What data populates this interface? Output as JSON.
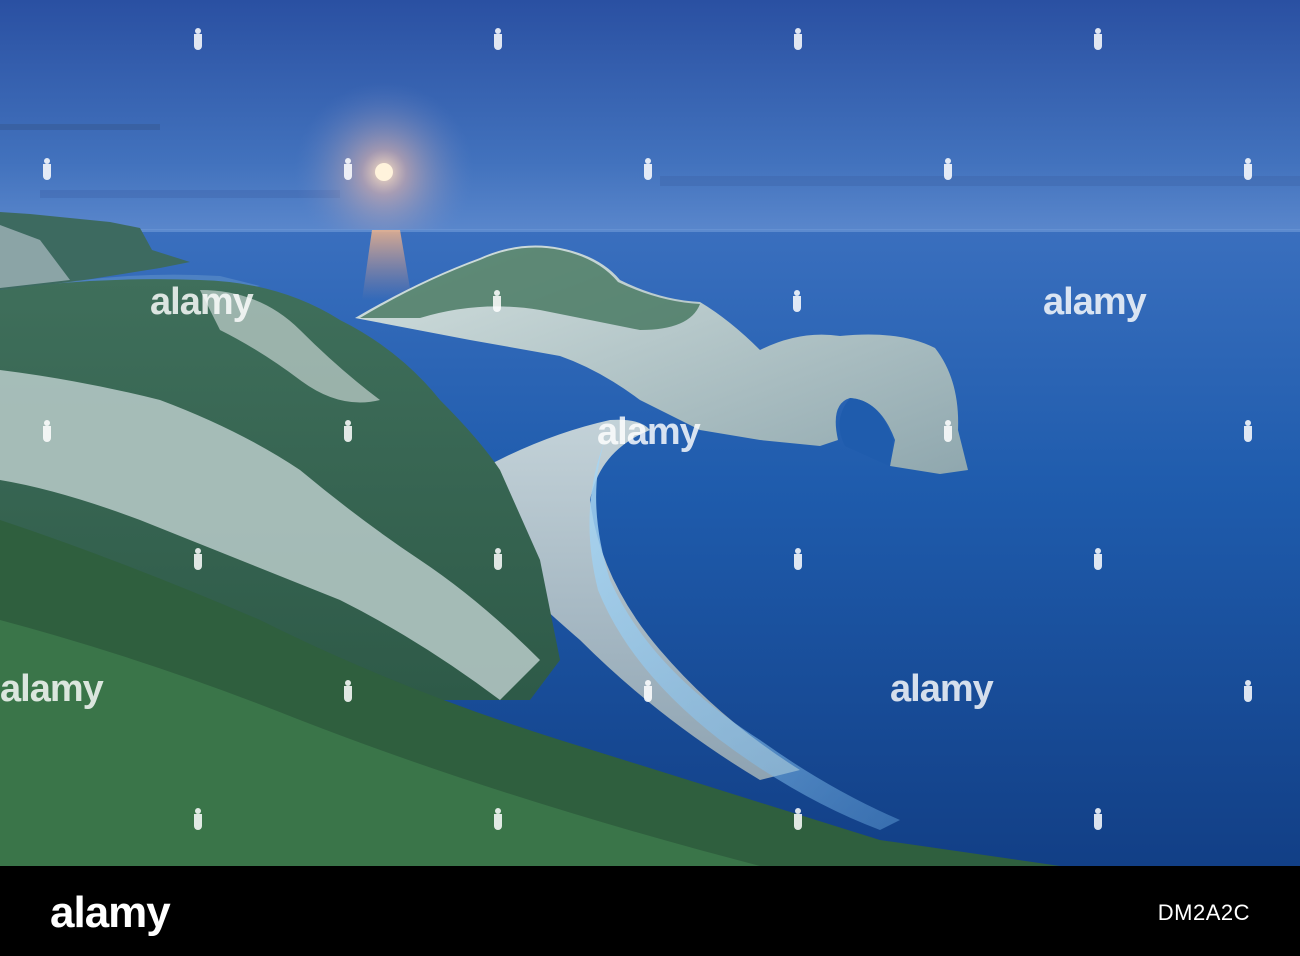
{
  "watermark": {
    "brand": "alamy"
  },
  "footer": {
    "logo": "alamy",
    "image_id": "DM2A2C"
  },
  "colors": {
    "sky_top": "#2f58a8",
    "sky_horizon": "#4d7cc6",
    "sea": "#1f5fb0",
    "sea_deep": "#0e3f86",
    "grass": "#3d6b56",
    "cliff": "#c9d8d6",
    "beach": "#b8c8cf",
    "moon": "#ffe9c9",
    "footer_bg": "#000000"
  }
}
